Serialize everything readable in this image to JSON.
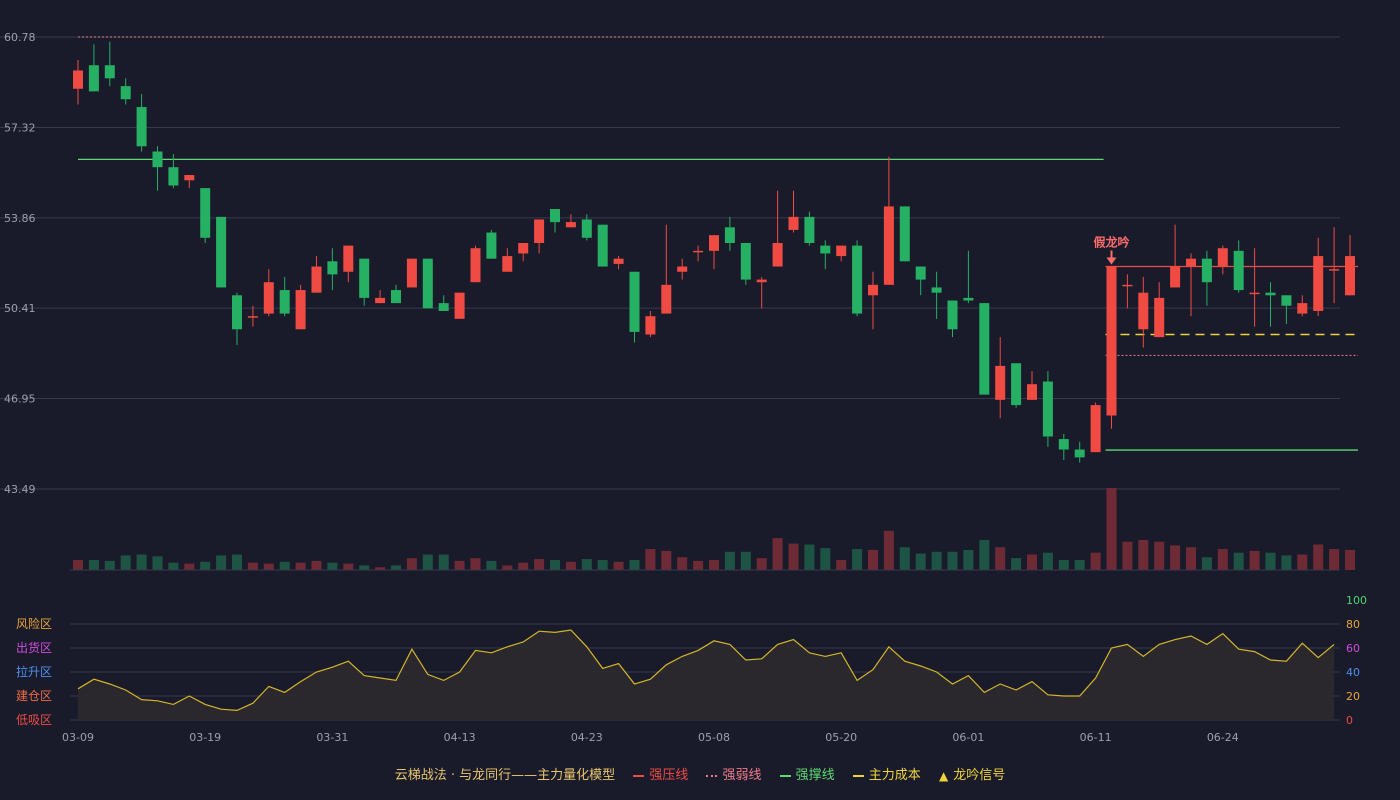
{
  "colors": {
    "background": "#191b2b",
    "grid": "#363a4d",
    "up": "#ef4b42",
    "down": "#26b063",
    "vol_up": "#6e2b35",
    "vol_down": "#1e5443",
    "pressure": "#ef4b42",
    "weak": "#f07c86",
    "support": "#5fd872",
    "cost": "#f0d33a",
    "signal": "#ff6b6b",
    "indicator_line": "#d4b52b",
    "indicator_fill": "#2c2a2c"
  },
  "chart_data": {
    "type": "candlestick",
    "price_axis": {
      "ticks": [
        "60.78",
        "57.32",
        "53.86",
        "50.41",
        "46.95",
        "43.49"
      ],
      "range": [
        43.49,
        60.78
      ]
    },
    "x_axis": {
      "ticks": [
        [
          "03-09",
          0
        ],
        [
          "03-19",
          8
        ],
        [
          "03-31",
          16
        ],
        [
          "04-13",
          24
        ],
        [
          "04-23",
          32
        ],
        [
          "05-08",
          40
        ],
        [
          "05-20",
          48
        ],
        [
          "06-01",
          56
        ],
        [
          "06-11",
          64
        ],
        [
          "06-24",
          72
        ]
      ]
    },
    "candles": [
      [
        58.8,
        59.5,
        59.9,
        58.2
      ],
      [
        59.7,
        58.7,
        60.5,
        58.7
      ],
      [
        59.7,
        59.2,
        60.6,
        58.9
      ],
      [
        58.9,
        58.4,
        59.2,
        58.2
      ],
      [
        58.1,
        56.6,
        58.6,
        56.4
      ],
      [
        56.4,
        55.8,
        56.6,
        54.9
      ],
      [
        55.8,
        55.1,
        56.3,
        55.0
      ],
      [
        55.3,
        55.5,
        55.5,
        55.0
      ],
      [
        55.0,
        53.1,
        55.0,
        52.9
      ],
      [
        53.9,
        51.2,
        53.9,
        51.2
      ],
      [
        50.9,
        49.6,
        51.0,
        49.0
      ],
      [
        50.1,
        50.1,
        50.5,
        49.7
      ],
      [
        50.2,
        51.4,
        51.9,
        50.1
      ],
      [
        51.1,
        50.2,
        51.6,
        50.1
      ],
      [
        49.6,
        51.1,
        51.3,
        49.6
      ],
      [
        51.0,
        52.0,
        52.4,
        51.0
      ],
      [
        52.2,
        51.7,
        52.7,
        51.1
      ],
      [
        51.8,
        52.8,
        52.8,
        51.4
      ],
      [
        52.3,
        50.8,
        52.3,
        50.5
      ],
      [
        50.6,
        50.8,
        51.1,
        50.6
      ],
      [
        51.1,
        50.6,
        51.3,
        50.6
      ],
      [
        51.2,
        52.3,
        52.3,
        51.2
      ],
      [
        52.3,
        50.4,
        52.3,
        50.4
      ],
      [
        50.6,
        50.3,
        50.9,
        50.3
      ],
      [
        50.0,
        51.0,
        51.0,
        50.0
      ],
      [
        51.4,
        52.7,
        52.8,
        51.4
      ],
      [
        53.3,
        52.3,
        53.4,
        52.3
      ],
      [
        51.8,
        52.4,
        52.7,
        51.8
      ],
      [
        52.5,
        52.9,
        52.9,
        52.2
      ],
      [
        52.9,
        53.8,
        53.8,
        52.5
      ],
      [
        54.2,
        53.7,
        54.2,
        53.3
      ],
      [
        53.5,
        53.7,
        54.0,
        53.5
      ],
      [
        53.8,
        53.1,
        54.0,
        53.0
      ],
      [
        53.6,
        52.0,
        53.6,
        52.0
      ],
      [
        52.1,
        52.3,
        52.4,
        51.9
      ],
      [
        51.8,
        49.5,
        51.8,
        49.1
      ],
      [
        49.4,
        50.1,
        50.3,
        49.3
      ],
      [
        50.2,
        51.3,
        53.6,
        50.2
      ],
      [
        51.8,
        52.0,
        52.3,
        51.5
      ],
      [
        52.6,
        52.6,
        52.8,
        52.2
      ],
      [
        52.6,
        53.2,
        53.2,
        51.9
      ],
      [
        53.5,
        52.9,
        53.9,
        52.6
      ],
      [
        52.9,
        51.5,
        52.9,
        51.3
      ],
      [
        51.4,
        51.5,
        51.6,
        50.4
      ],
      [
        52.0,
        52.9,
        54.9,
        52.0
      ],
      [
        53.4,
        53.9,
        54.9,
        53.3
      ],
      [
        53.9,
        52.9,
        54.1,
        52.8
      ],
      [
        52.8,
        52.5,
        53.0,
        51.9
      ],
      [
        52.4,
        52.8,
        52.8,
        52.2
      ],
      [
        52.8,
        50.2,
        53.0,
        50.1
      ],
      [
        50.9,
        51.3,
        51.8,
        49.6
      ],
      [
        51.3,
        54.3,
        56.2,
        51.3
      ],
      [
        54.3,
        52.2,
        54.3,
        52.2
      ],
      [
        52.0,
        51.5,
        52.0,
        50.9
      ],
      [
        51.2,
        51.0,
        51.8,
        50.0
      ],
      [
        50.7,
        49.6,
        50.7,
        49.3
      ],
      [
        50.8,
        50.7,
        52.6,
        50.6
      ],
      [
        50.6,
        47.1,
        50.6,
        47.1
      ],
      [
        46.9,
        48.2,
        49.3,
        46.2
      ],
      [
        48.3,
        46.7,
        48.3,
        46.6
      ],
      [
        46.9,
        47.5,
        48.0,
        46.9
      ],
      [
        47.6,
        45.5,
        48.0,
        45.1
      ],
      [
        45.4,
        45.0,
        45.6,
        44.6
      ],
      [
        45.0,
        44.7,
        45.3,
        44.5
      ],
      [
        44.9,
        46.7,
        46.8,
        44.9
      ],
      [
        46.3,
        52.0,
        52.0,
        45.8
      ],
      [
        51.3,
        51.3,
        51.7,
        50.4
      ],
      [
        49.6,
        51.0,
        51.6,
        48.9
      ],
      [
        49.3,
        50.8,
        51.4,
        49.3
      ],
      [
        51.2,
        52.0,
        53.6,
        51.2
      ],
      [
        52.0,
        52.3,
        52.5,
        50.1
      ],
      [
        52.3,
        51.4,
        52.6,
        50.5
      ],
      [
        52.0,
        52.7,
        52.8,
        51.7
      ],
      [
        52.6,
        51.1,
        53.0,
        51.0
      ],
      [
        51.0,
        51.0,
        52.7,
        49.7
      ],
      [
        51.0,
        50.9,
        51.4,
        49.7
      ],
      [
        50.9,
        50.5,
        50.9,
        49.8
      ],
      [
        50.2,
        50.6,
        50.9,
        50.1
      ],
      [
        50.3,
        52.4,
        53.1,
        50.1
      ],
      [
        51.9,
        51.9,
        53.5,
        50.6
      ],
      [
        50.9,
        52.4,
        53.2,
        50.9
      ]
    ],
    "volume": [
      11,
      11,
      10,
      16,
      17,
      15,
      8,
      7,
      9,
      16,
      17,
      8,
      7,
      9,
      8,
      10,
      8,
      7,
      5,
      3,
      5,
      13,
      17,
      17,
      10,
      13,
      10,
      5,
      8,
      12,
      11,
      9,
      12,
      11,
      9,
      11,
      23,
      21,
      14,
      10,
      11,
      20,
      20,
      13,
      35,
      29,
      28,
      24,
      11,
      23,
      22,
      43,
      25,
      18,
      20,
      20,
      22,
      33,
      25,
      13,
      17,
      19,
      11,
      11,
      19,
      90,
      31,
      33,
      31,
      27,
      25,
      14,
      23,
      19,
      21,
      19,
      16,
      17,
      28,
      23,
      22
    ],
    "indicator": {
      "y_ticks": [
        100,
        80,
        60,
        40,
        20,
        0
      ],
      "zones": [
        "风险区",
        "出货区",
        "拉升区",
        "建仓区",
        "低吸区"
      ],
      "values": [
        26,
        34,
        30,
        25,
        17,
        16,
        13,
        20,
        13,
        9,
        8,
        14,
        28,
        23,
        32,
        40,
        44,
        49,
        37,
        35,
        33,
        59,
        38,
        33,
        40,
        58,
        56,
        61,
        65,
        74,
        73,
        75,
        61,
        43,
        47,
        30,
        34,
        46,
        53,
        58,
        66,
        63,
        50,
        51,
        63,
        67,
        56,
        53,
        56,
        33,
        42,
        61,
        49,
        45,
        40,
        30,
        37,
        23,
        30,
        25,
        32,
        21,
        20,
        20,
        35,
        60,
        63,
        53,
        63,
        67,
        70,
        63,
        72,
        59,
        57,
        50,
        49,
        64,
        52,
        63
      ]
    },
    "levels": [
      {
        "type": "weak",
        "value": 60.78,
        "from": 0,
        "to": 64
      },
      {
        "type": "support",
        "value": 56.1,
        "from": 0,
        "to": 64
      },
      {
        "type": "pressure",
        "value": 52.0,
        "from": 65,
        "to": 80
      },
      {
        "type": "cost",
        "value": 49.4,
        "from": 65,
        "to": 80
      },
      {
        "type": "weak",
        "value": 48.6,
        "from": 65,
        "to": 80
      },
      {
        "type": "support",
        "value": 44.98,
        "from": 65,
        "to": 80
      }
    ],
    "signal": {
      "label": "假龙吟",
      "index": 65
    }
  },
  "legend": {
    "title": "云梯战法 · 与龙同行——主力量化模型",
    "items": [
      {
        "label": "强压线",
        "style": "solid",
        "color": "#ef4b42"
      },
      {
        "label": "强弱线",
        "style": "dotted",
        "color": "#f07c86"
      },
      {
        "label": "强撑线",
        "style": "solid",
        "color": "#5fd872"
      },
      {
        "label": "主力成本",
        "style": "dashed",
        "color": "#f0d33a"
      },
      {
        "label": "龙吟信号",
        "style": "triangle",
        "color": "#f0d33a"
      }
    ]
  }
}
